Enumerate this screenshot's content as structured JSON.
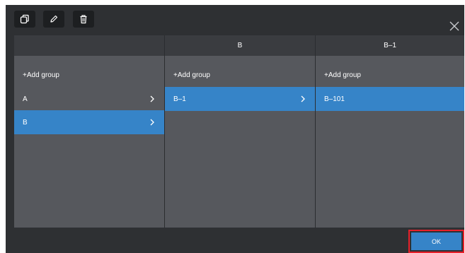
{
  "toolbar": {
    "icons": [
      "copy-icon",
      "edit-icon",
      "delete-icon",
      "close-icon"
    ]
  },
  "columns": [
    {
      "header": "",
      "add_label": "+Add group",
      "items": [
        {
          "label": "A",
          "selected": false,
          "has_children": true
        },
        {
          "label": "B",
          "selected": true,
          "has_children": true
        }
      ]
    },
    {
      "header": "B",
      "add_label": "+Add group",
      "items": [
        {
          "label": "B–1",
          "selected": true,
          "has_children": true
        }
      ]
    },
    {
      "header": "B–1",
      "add_label": "+Add group",
      "items": [
        {
          "label": "B–101",
          "selected": true,
          "has_children": false
        }
      ]
    }
  ],
  "footer": {
    "ok_label": "OK"
  },
  "colors": {
    "selected": "#3684c8",
    "highlight_outline": "#e8202a",
    "panel": "#56585d",
    "frame": "#2e3033"
  }
}
